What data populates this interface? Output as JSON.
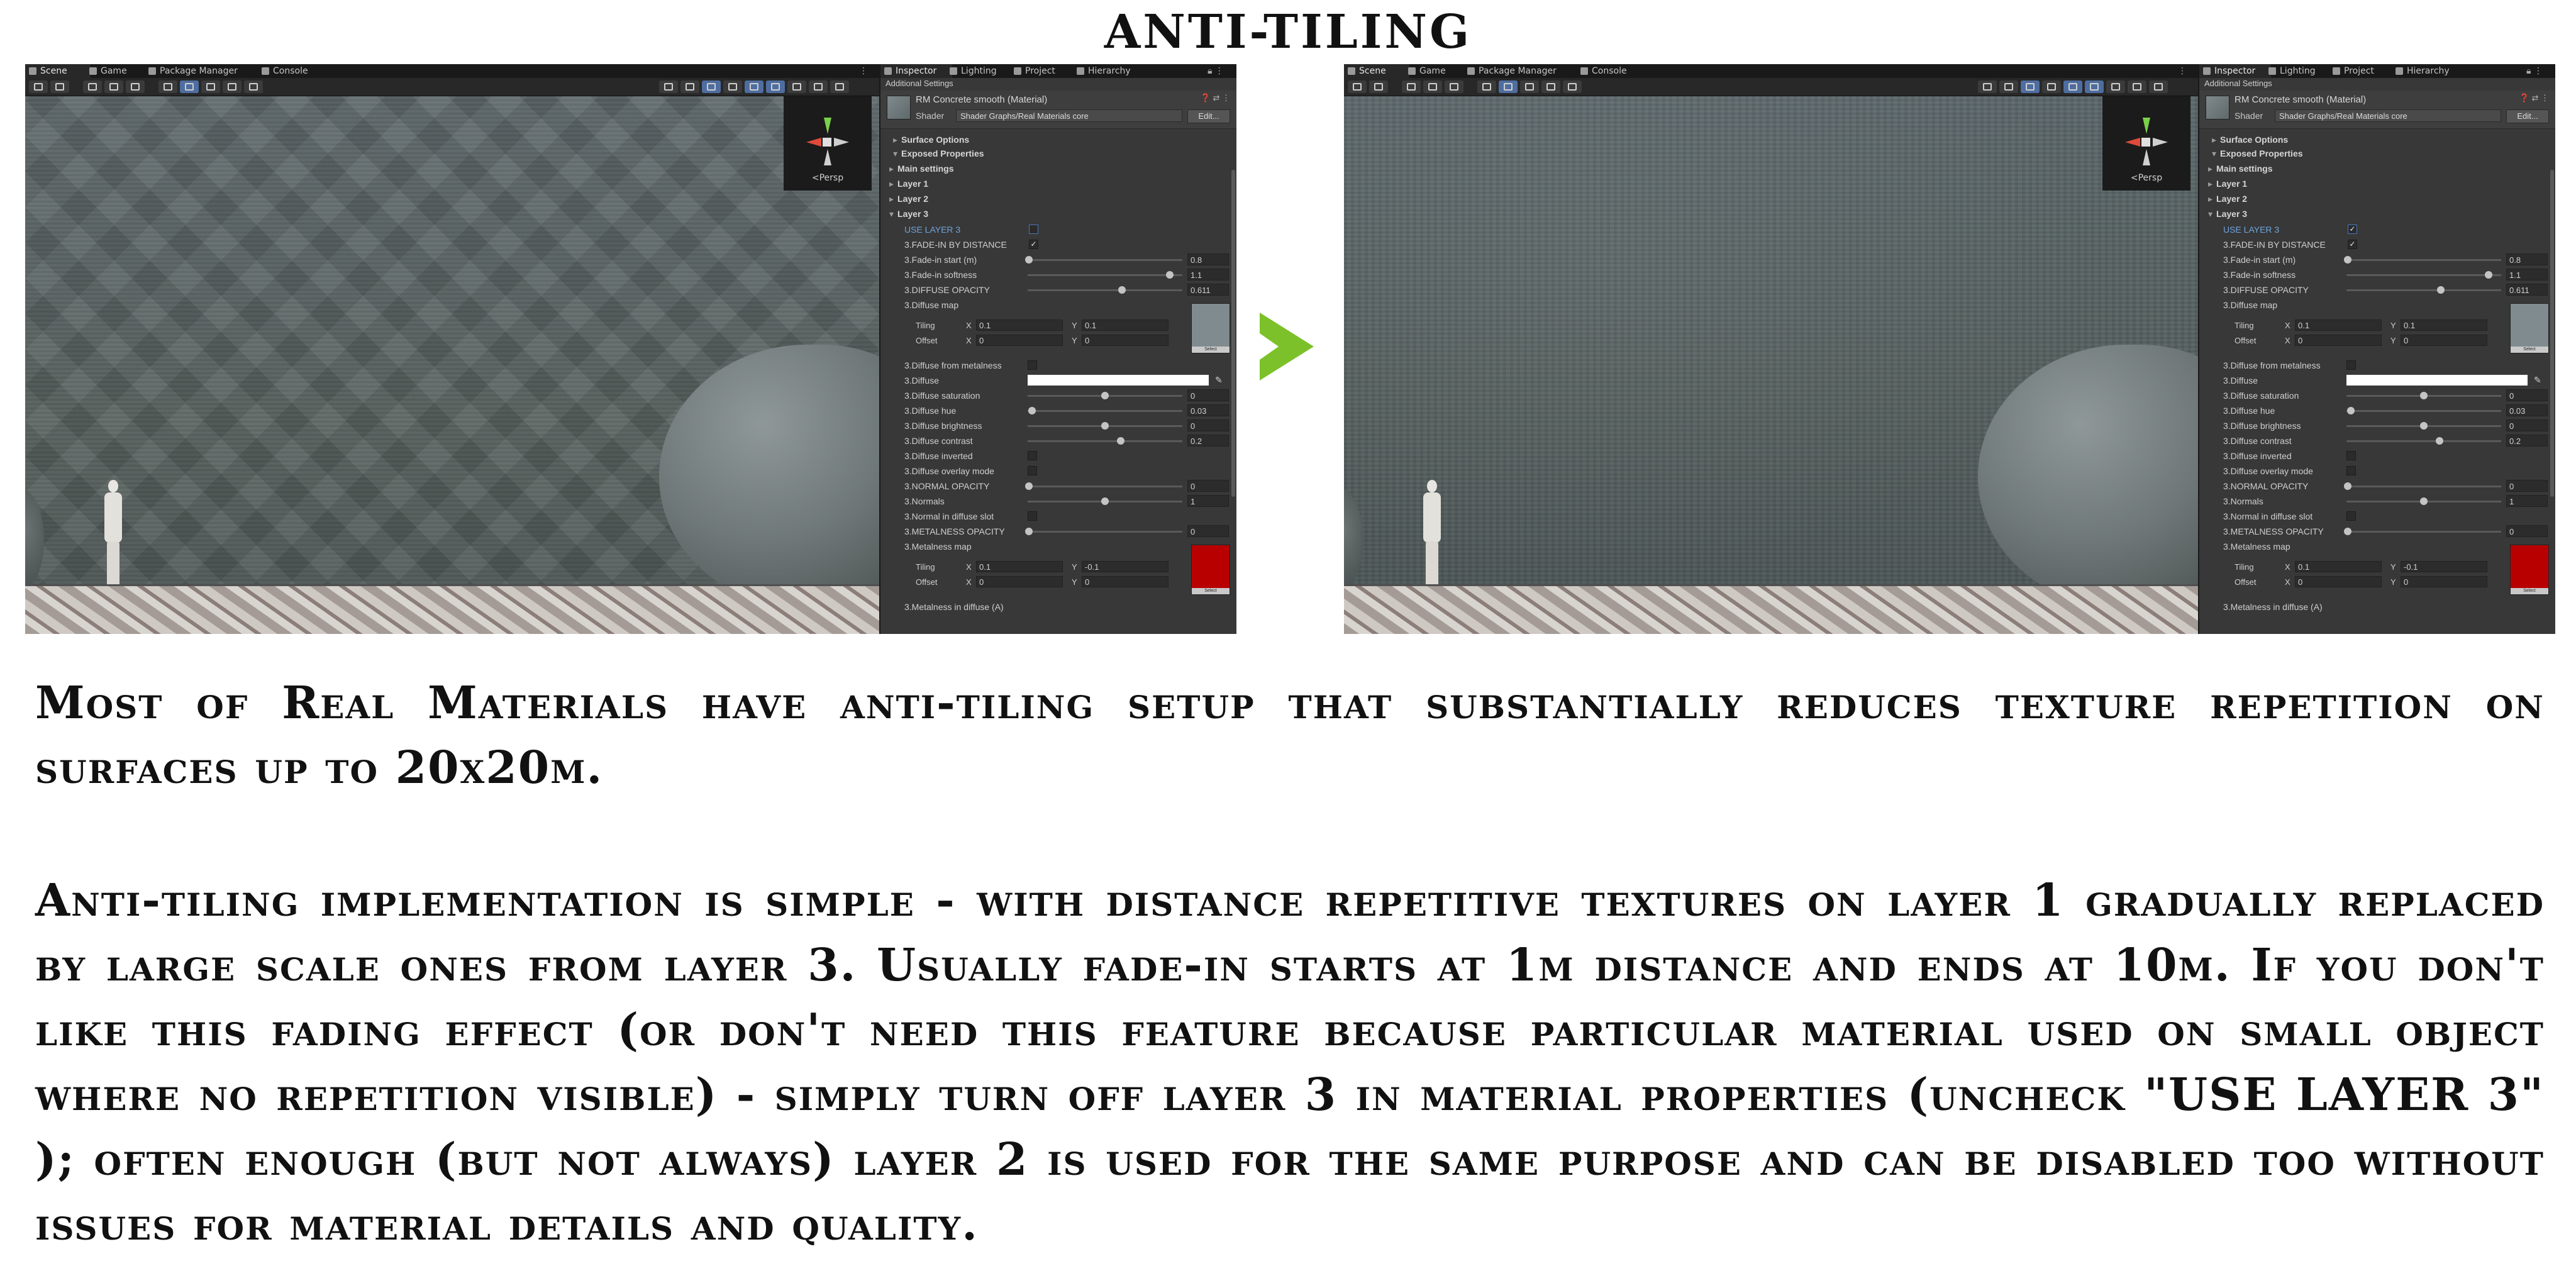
{
  "title": "ANTI-TILING",
  "paragraph1": "Most of Real Materials have anti-tiling setup that substantially reduces texture repetition on surfaces up to 20x20m.",
  "paragraph2": "Anti-tiling implementation is simple - with distance repetitive textures on layer 1 gradually replaced by large scale ones from layer 3.  Usually fade-in starts at 1m distance and ends at 10m. If you don't like this fading effect (or don't need this feature because particular material used on small object where no repetition visible) - simply turn off layer 3 in material properties (uncheck \"USE LAYER 3\" ); often enough (but not always) layer 2 is used for the same purpose and can be disabled too without issues for material details and quality.",
  "arrow_color": "#7cc12a",
  "editor": {
    "scene_tabs": [
      "Scene",
      "Game",
      "Package Manager",
      "Console"
    ],
    "inspector_tabs": [
      "Inspector",
      "Lighting",
      "Project",
      "Hierarchy"
    ],
    "gizmo_label": "<Persp",
    "additional_settings": "Additional Settings",
    "material_name": "RM Concrete smooth (Material)",
    "shader_label": "Shader",
    "shader_value": "Shader Graphs/Real Materials core",
    "edit_button": "Edit...",
    "header_icons": "❓ ⇄ ⋮",
    "groups": {
      "surface_options": "Surface Options",
      "exposed_properties": "Exposed Properties",
      "main_settings": "Main settings",
      "layer1": "Layer 1",
      "layer2": "Layer 2",
      "layer3": "Layer 3"
    },
    "props": {
      "use_layer3": "USE LAYER 3",
      "fade_by_distance": "3.FADE-IN BY DISTANCE",
      "fade_start": "3.Fade-in start (m)",
      "fade_start_val": "0.8",
      "fade_softness": "3.Fade-in softness",
      "fade_softness_val": "1.1",
      "diffuse_opacity": "3.DIFFUSE OPACITY",
      "diffuse_opacity_val": "0.611",
      "diffuse_map": "3.Diffuse map",
      "tiling": "Tiling",
      "offset": "Offset",
      "x": "X",
      "y": "Y",
      "tiling_x": "0.1",
      "tiling_y": "0.1",
      "offset_x": "0",
      "offset_y": "0",
      "diffuse_from_metalness": "3.Diffuse from metalness",
      "diffuse": "3.Diffuse",
      "diffuse_saturation": "3.Diffuse saturation",
      "diffuse_saturation_val": "0",
      "diffuse_hue": "3.Diffuse hue",
      "diffuse_hue_val": "0.03",
      "diffuse_brightness": "3.Diffuse brightness",
      "diffuse_brightness_val": "0",
      "diffuse_contrast": "3.Diffuse contrast",
      "diffuse_contrast_val": "0.2",
      "diffuse_inverted": "3.Diffuse inverted",
      "diffuse_overlay": "3.Diffuse overlay mode",
      "normal_opacity": "3.NORMAL OPACITY",
      "normal_opacity_val": "0",
      "normals": "3.Normals",
      "normals_val": "1",
      "normal_in_diffuse": "3.Normal in diffuse slot",
      "metalness_opacity": "3.METALNESS OPACITY",
      "metalness_opacity_val": "0",
      "metalness_map": "3.Metalness map",
      "metal_tiling_x": "0.1",
      "metal_tiling_y": "-0.1",
      "metal_offset_x": "0",
      "metal_offset_y": "0",
      "metalness_in_diffuse": "3.Metalness in diffuse (A)",
      "select": "Select"
    },
    "left_use_layer3_checked": "",
    "right_use_layer3_checked": "✓",
    "fade_checked": "✓",
    "metal_map_color": "#b80000",
    "diffuse_map_color": "#7f8b8e"
  }
}
